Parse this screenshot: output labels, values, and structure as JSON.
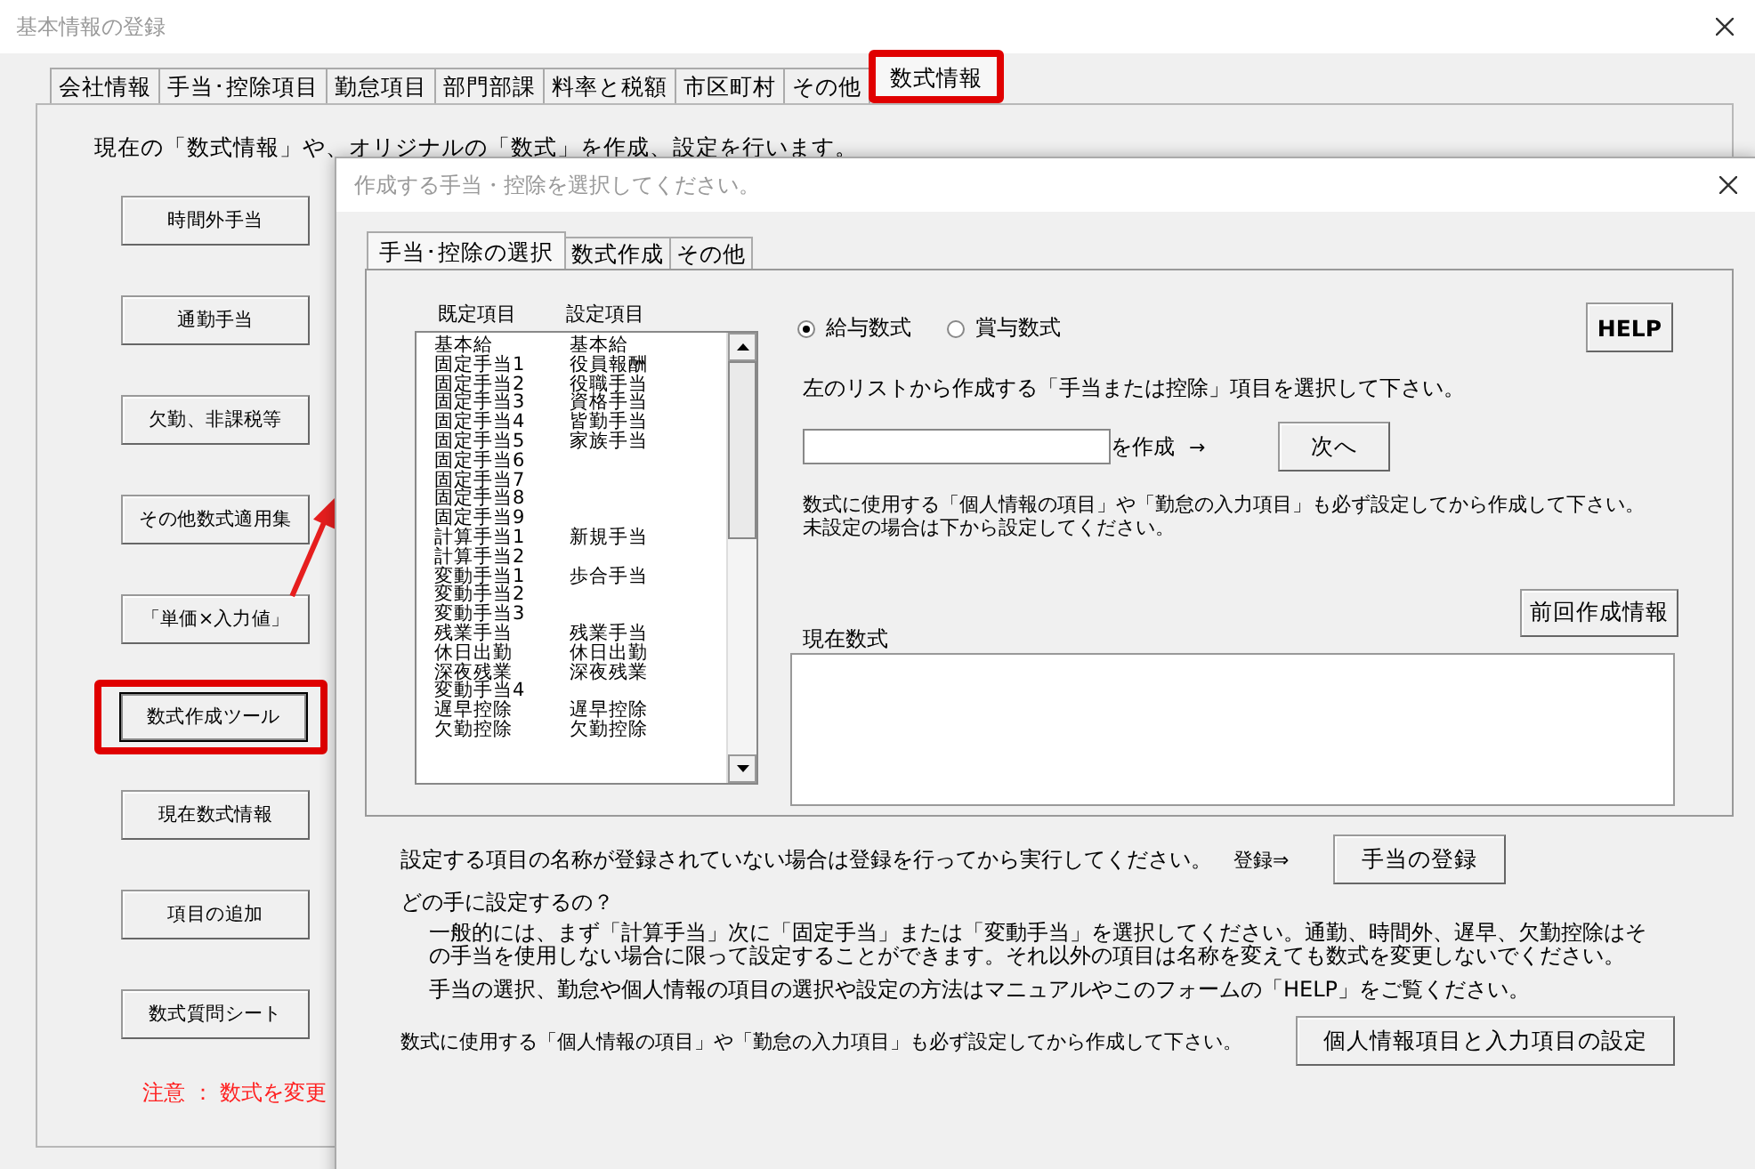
{
  "window": {
    "title": "基本情報の登録"
  },
  "tabs": [
    {
      "label": "会社情報",
      "selected": false,
      "highlighted": false
    },
    {
      "label": "手当･控除項目",
      "selected": false,
      "highlighted": false
    },
    {
      "label": "勤怠項目",
      "selected": false,
      "highlighted": false
    },
    {
      "label": "部門部課",
      "selected": false,
      "highlighted": false
    },
    {
      "label": "料率と税額",
      "selected": false,
      "highlighted": false
    },
    {
      "label": "市区町村",
      "selected": false,
      "highlighted": false
    },
    {
      "label": "その他",
      "selected": false,
      "highlighted": false
    },
    {
      "label": "数式情報",
      "selected": true,
      "highlighted": true
    }
  ],
  "description": "現在の「数式情報」や、オリジナルの「数式」を作成、設定を行います。",
  "side_buttons": [
    {
      "label": "時間外手当",
      "highlighted": false
    },
    {
      "label": "通勤手当",
      "highlighted": false
    },
    {
      "label": "欠勤、非課税等",
      "highlighted": false
    },
    {
      "label": "その他数式適用集",
      "highlighted": false
    },
    {
      "label": "「単価×入力値」",
      "highlighted": false
    },
    {
      "label": "数式作成ツール",
      "highlighted": true
    },
    {
      "label": "現在数式情報",
      "highlighted": false
    },
    {
      "label": "項目の追加",
      "highlighted": false
    },
    {
      "label": "数式質問シート",
      "highlighted": false
    }
  ],
  "warning": "注意 ： 数式を変更",
  "dialog": {
    "title": "作成する手当・控除を選択してください。",
    "tabs": [
      {
        "label": "手当･控除の選択",
        "selected": true
      },
      {
        "label": "数式作成",
        "selected": false
      },
      {
        "label": "その他",
        "selected": false
      }
    ],
    "list": {
      "columns": [
        "既定項目",
        "設定項目"
      ],
      "rows": [
        {
          "default": "基本給",
          "setting": "基本給"
        },
        {
          "default": "固定手当1",
          "setting": "役員報酬"
        },
        {
          "default": "固定手当2",
          "setting": "役職手当"
        },
        {
          "default": "固定手当3",
          "setting": "資格手当"
        },
        {
          "default": "固定手当4",
          "setting": "皆勤手当"
        },
        {
          "default": "固定手当5",
          "setting": "家族手当"
        },
        {
          "default": "固定手当6"
        },
        {
          "default": "固定手当7"
        },
        {
          "default": "固定手当8"
        },
        {
          "default": "固定手当9"
        },
        {
          "default": "計算手当1",
          "setting": "新規手当"
        },
        {
          "default": "計算手当2"
        },
        {
          "default": "変動手当1",
          "setting": "歩合手当"
        },
        {
          "default": "変動手当2"
        },
        {
          "default": "変動手当3"
        },
        {
          "default": "残業手当",
          "setting": "残業手当"
        },
        {
          "default": "休日出勤",
          "setting": "休日出勤"
        },
        {
          "default": "深夜残業",
          "setting": "深夜残業"
        },
        {
          "default": "変動手当4"
        },
        {
          "default": "遅早控除",
          "setting": "遅早控除"
        },
        {
          "default": "欠勤控除",
          "setting": "欠勤控除"
        }
      ]
    },
    "radios": [
      {
        "label": "給与数式",
        "selected": true
      },
      {
        "label": "賞与数式",
        "selected": false
      }
    ],
    "help_button": "HELP",
    "instruction": "左のリストから作成する「手当または控除」項目を選択して下さい。",
    "create_suffix": "を作成",
    "create_arrow": "→",
    "next_button": "次へ",
    "note_lines": [
      "数式に使用する「個人情報の項目」や「勤怠の入力項目」も必ず設定してから作成して下さい。",
      "未設定の場合は下から設定してください。"
    ],
    "previous_button": "前回作成情報",
    "formula_label": "現在数式",
    "register_text": "設定する項目の名称が登録されていない場合は登録を行ってから実行してください。",
    "register_arrow": "登録⇒",
    "register_button": "手当の登録",
    "question": "どの手に設定するの？",
    "explanation": "一般的には、まず「計算手当」次に「固定手当」または「変動手当」を選択してください。通勤、時間外、遅早、欠勤控除はその手当を使用しない場合に限って設定することができます。それ以外の項目は名称を変えても数式を変更しないでください。",
    "manual_note": "手当の選択、勤怠や個人情報の項目の選択や設定の方法はマニュアルやこのフォームの「HELP」をご覧ください。",
    "bottom_note": "数式に使用する「個人情報の項目」や「勤怠の入力項目」も必ず設定してから作成して下さい。",
    "settings_button": "個人情報項目と入力項目の設定"
  }
}
